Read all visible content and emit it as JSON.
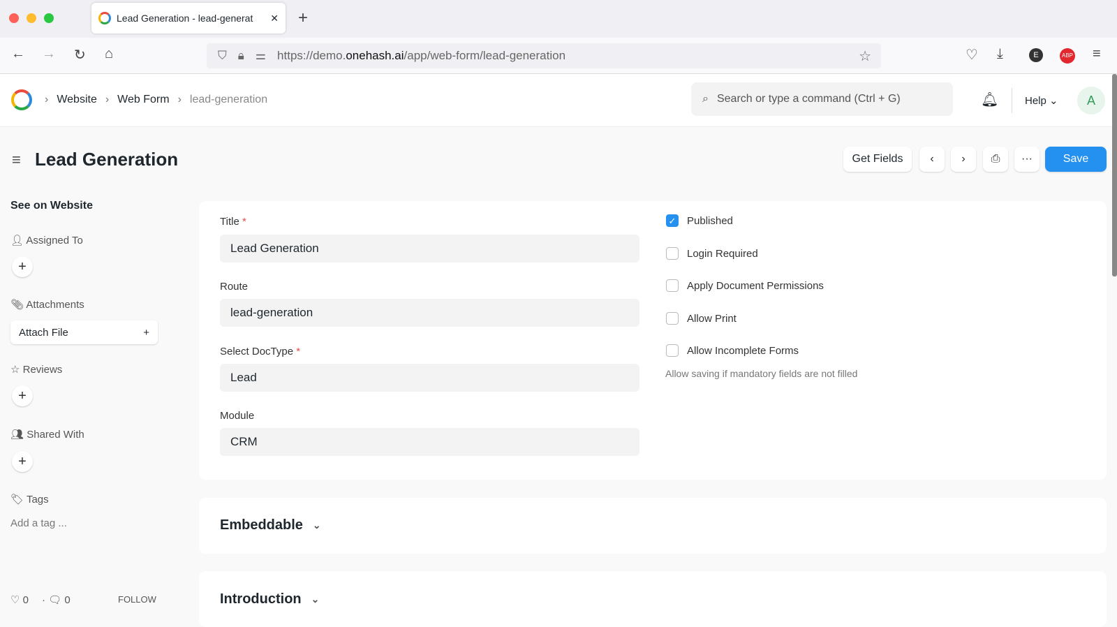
{
  "browser": {
    "tab_title": "Lead Generation - lead-generat",
    "url_prefix": "https://demo.",
    "url_host": "onehash.ai",
    "url_path": "/app/web-form/lead-generation",
    "ext_e": "E",
    "ext_abp": "ABP"
  },
  "header": {
    "breadcrumbs": [
      "Website",
      "Web Form",
      "lead-generation"
    ],
    "search_placeholder": "Search or type a command (Ctrl + G)",
    "help": "Help",
    "avatar": "A"
  },
  "page": {
    "title": "Lead Generation",
    "get_fields": "Get Fields",
    "more": "···",
    "save": "Save"
  },
  "sidebar": {
    "see_on_website": "See on Website",
    "assigned_to": "Assigned To",
    "attachments": "Attachments",
    "attach_file": "Attach File",
    "reviews": "Reviews",
    "shared_with": "Shared With",
    "tags": "Tags",
    "add_tag": "Add a tag ...",
    "likes": "0",
    "comments": "0",
    "follow": "FOLLOW"
  },
  "form": {
    "title_label": "Title",
    "title_value": "Lead Generation",
    "route_label": "Route",
    "route_value": "lead-generation",
    "doctype_label": "Select DocType",
    "doctype_value": "Lead",
    "module_label": "Module",
    "module_value": "CRM",
    "checks": [
      {
        "label": "Published",
        "checked": true
      },
      {
        "label": "Login Required",
        "checked": false
      },
      {
        "label": "Apply Document Permissions",
        "checked": false
      },
      {
        "label": "Allow Print",
        "checked": false
      },
      {
        "label": "Allow Incomplete Forms",
        "checked": false
      }
    ],
    "incomplete_hint": "Allow saving if mandatory fields are not filled"
  },
  "sections": [
    "Embeddable",
    "Introduction"
  ]
}
